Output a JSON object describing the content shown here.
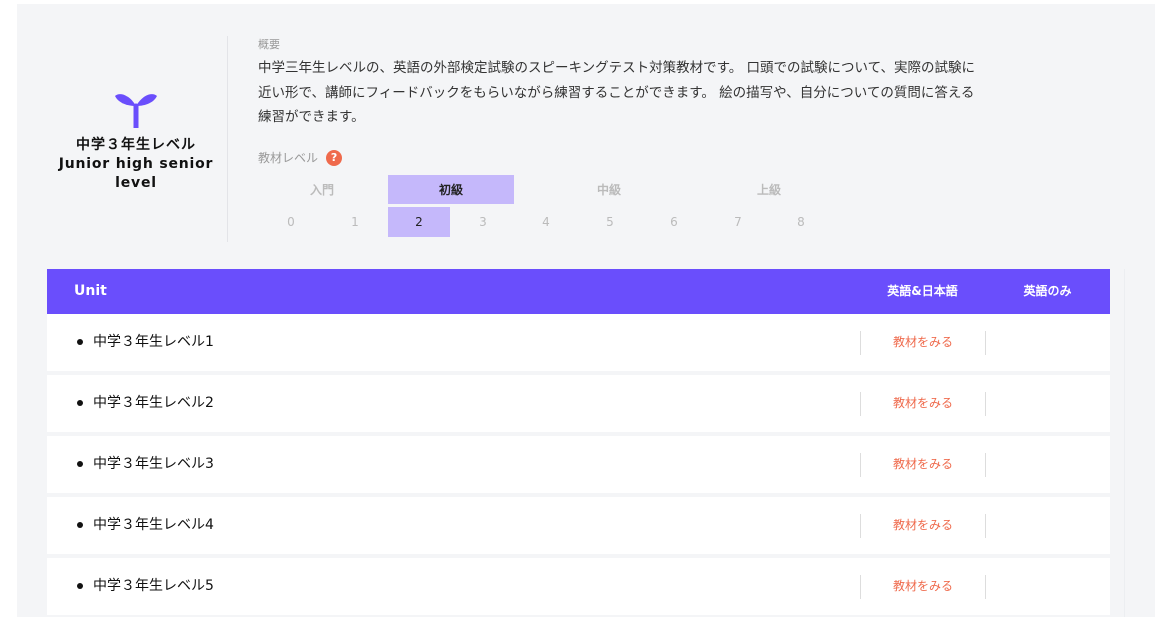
{
  "brand": {
    "title_jp": "中学３年生レベル",
    "title_en": "Junior high senior level",
    "icon": "sprout-icon",
    "icon_color": "#6a4efc"
  },
  "overview": {
    "label": "概要",
    "text": "中学三年生レベルの、英語の外部検定試験のスピーキングテスト対策教材です。 口頭での試験について、実際の試験に近い形で、講師にフィードバックをもらいながら練習することができます。 絵の描写や、自分についての質問に答える練習ができます。"
  },
  "level": {
    "label": "教材レベル",
    "help_icon": "?",
    "categories": [
      {
        "label": "入門",
        "active": false
      },
      {
        "label": "初級",
        "active": true
      },
      {
        "label": "中級",
        "active": false
      },
      {
        "label": "上級",
        "active": false
      }
    ],
    "numbers": [
      "0",
      "1",
      "2",
      "3",
      "4",
      "5",
      "6",
      "7",
      "8"
    ],
    "selected": "2",
    "highlight_color": "#c5b8fb"
  },
  "table": {
    "header": {
      "unit": "Unit",
      "col_bilingual": "英語&日本語",
      "col_english": "英語のみ"
    },
    "header_color": "#6a4efc",
    "link_color": "#ef6a4c",
    "rows": [
      {
        "name": "中学３年生レベル1",
        "link": "教材をみる"
      },
      {
        "name": "中学３年生レベル2",
        "link": "教材をみる"
      },
      {
        "name": "中学３年生レベル3",
        "link": "教材をみる"
      },
      {
        "name": "中学３年生レベル4",
        "link": "教材をみる"
      },
      {
        "name": "中学３年生レベル5",
        "link": "教材をみる"
      }
    ]
  }
}
